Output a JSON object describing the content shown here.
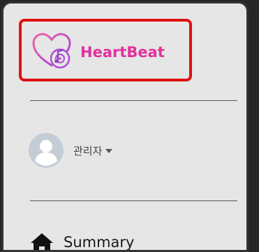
{
  "brand": {
    "name": "HeartBeat",
    "color": "#e0329c",
    "icon": "heart-music-note-icon"
  },
  "highlight_color": "#e01010",
  "user": {
    "name": "관리자",
    "avatar_icon": "default-avatar-icon",
    "menu_icon": "caret-down-icon"
  },
  "nav": {
    "items": [
      {
        "label": "Summary",
        "icon": "home-icon"
      }
    ]
  }
}
